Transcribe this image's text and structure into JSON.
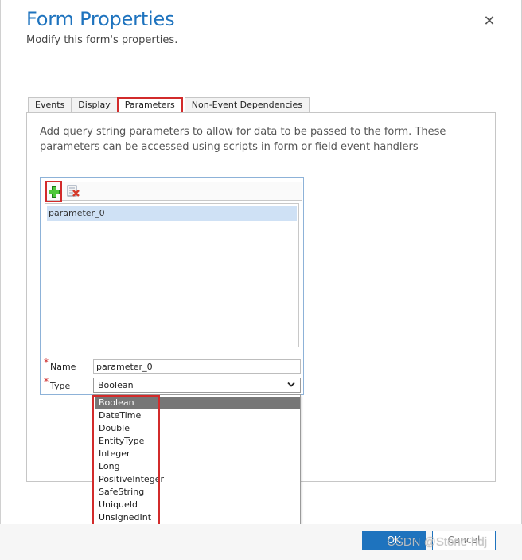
{
  "dialog": {
    "title": "Form Properties",
    "subtitle": "Modify this form's properties.",
    "close_glyph": "✕"
  },
  "tabs": [
    {
      "label": "Events",
      "active": false
    },
    {
      "label": "Display",
      "active": false
    },
    {
      "label": "Parameters",
      "active": true
    },
    {
      "label": "Non-Event Dependencies",
      "active": false
    }
  ],
  "parameters": {
    "description": "Add query string parameters to allow for data to be passed to the form. These parameters can be accessed using scripts in form or field event handlers",
    "toolbar": {
      "add_icon": "add-plus-icon",
      "delete_icon": "delete-icon"
    },
    "list": [
      "parameter_0"
    ],
    "required_marker": "*",
    "name_label": "Name",
    "name_value": "parameter_0",
    "type_label": "Type",
    "type_value": "Boolean",
    "type_options": [
      "Boolean",
      "DateTime",
      "Double",
      "EntityType",
      "Integer",
      "Long",
      "PositiveInteger",
      "SafeString",
      "UniqueId",
      "UnsignedInt"
    ]
  },
  "footer": {
    "ok_label": "OK",
    "cancel_label": "Cancel"
  },
  "watermark": "CSDN @Stone-hdj",
  "colors": {
    "accent": "#1e73be",
    "highlight": "#d22b2b",
    "selection": "#cfe1f5"
  }
}
